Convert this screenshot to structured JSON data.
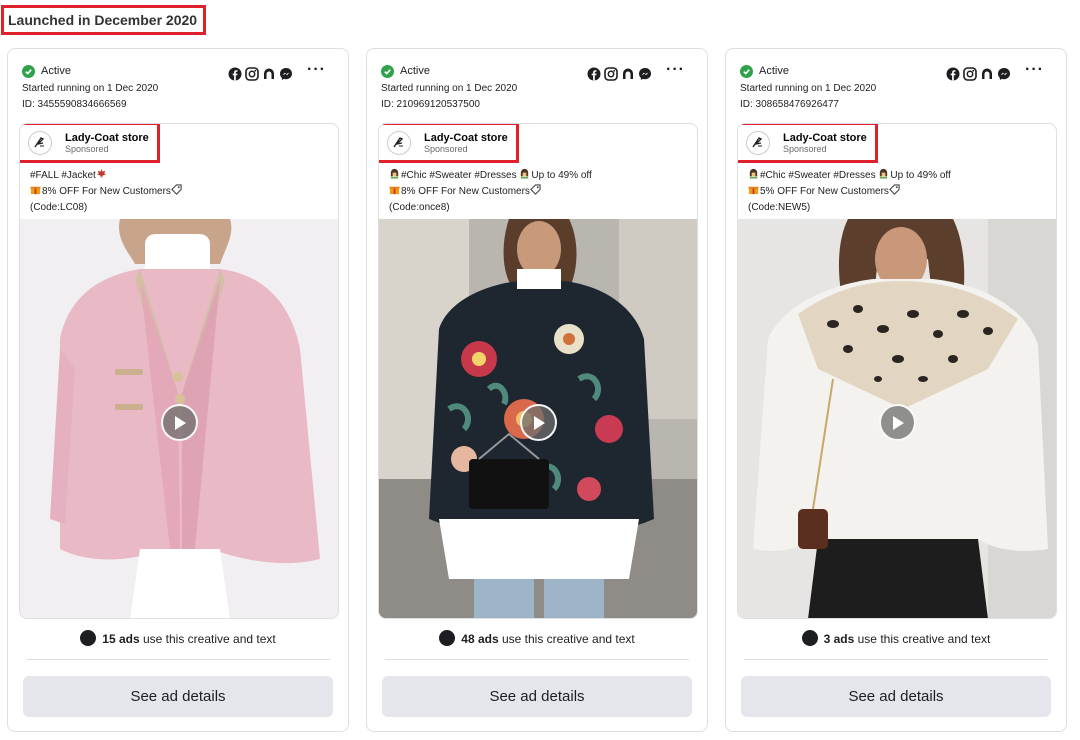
{
  "section_title": "Launched in December 2020",
  "colors": {
    "highlight": "#e0202a",
    "active_green": "#31a24c",
    "button_bg": "#e4e6eb"
  },
  "platform_icons": [
    "facebook-icon",
    "instagram-icon",
    "audience-network-icon",
    "messenger-icon"
  ],
  "cards": [
    {
      "status": "Active",
      "started": "Started running on 1 Dec 2020",
      "id": "ID: 3455590834666569",
      "advertiser": "Lady-Coat store",
      "sponsored": "Sponsored",
      "copy_line1": "#FALL #Jacket",
      "copy_line2": "8% OFF For New Customers",
      "copy_line3": "(Code:LC08)",
      "ads_count": "15 ads",
      "ads_suffix": " use this creative and text",
      "button": "See ad details"
    },
    {
      "status": "Active",
      "started": "Started running on 1 Dec 2020",
      "id": "ID: 210969120537500",
      "advertiser": "Lady-Coat store",
      "sponsored": "Sponsored",
      "copy_line1": "#Chic #Sweater #Dresses",
      "copy_line1b": "Up to 49% off",
      "copy_line2": "8% OFF For New Customers",
      "copy_line3": "(Code:once8)",
      "ads_count": "48 ads",
      "ads_suffix": " use this creative and text",
      "button": "See ad details"
    },
    {
      "status": "Active",
      "started": "Started running on 1 Dec 2020",
      "id": "ID: 308658476926477",
      "advertiser": "Lady-Coat store",
      "sponsored": "Sponsored",
      "copy_line1": "#Chic #Sweater #Dresses",
      "copy_line1b": "Up to 49% off",
      "copy_line2": "5% OFF For New Customers",
      "copy_line3": "(Code:NEW5)",
      "ads_count": "3 ads",
      "ads_suffix": " use this creative and text",
      "button": "See ad details"
    }
  ]
}
